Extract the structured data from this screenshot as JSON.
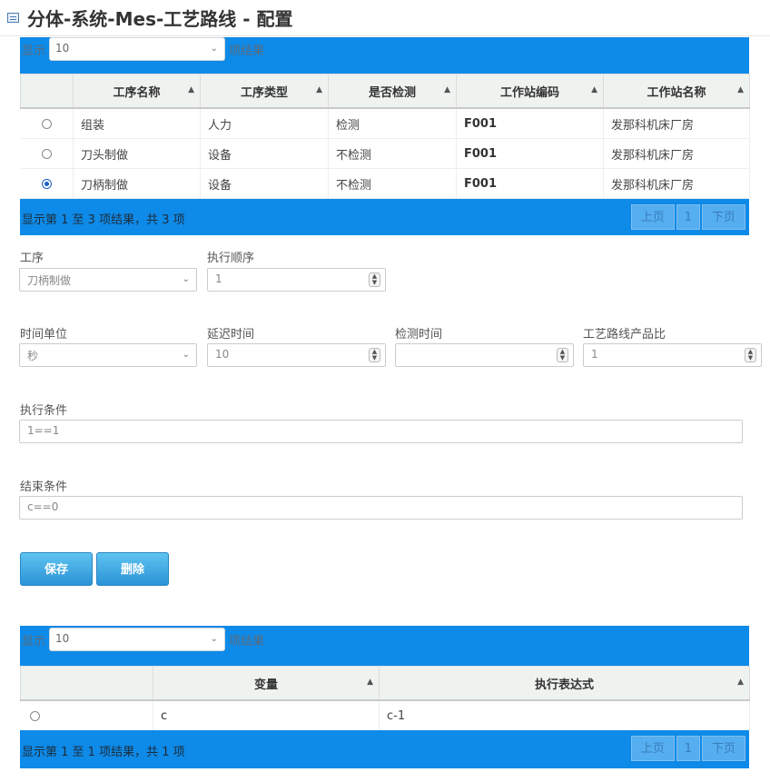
{
  "page": {
    "title": "分体-系统-Mes-工艺路线 - 配置"
  },
  "table1": {
    "length_prefix": "显示",
    "length_value": "10",
    "length_suffix": "项结果",
    "headers": [
      "",
      "工序名称",
      "工序类型",
      "是否检测",
      "工作站编码",
      "工作站名称"
    ],
    "rows": [
      {
        "selected": false,
        "name": "组装",
        "type": "人力",
        "check": "检测",
        "code": "F001",
        "station": "发那科机床厂房"
      },
      {
        "selected": false,
        "name": "刀头制做",
        "type": "设备",
        "check": "不检测",
        "code": "F001",
        "station": "发那科机床厂房"
      },
      {
        "selected": true,
        "name": "刀柄制做",
        "type": "设备",
        "check": "不检测",
        "code": "F001",
        "station": "发那科机床厂房"
      }
    ],
    "info": "显示第 1 至 3 项结果，共 3 项",
    "pager": {
      "prev": "上页",
      "page": "1",
      "next": "下页"
    }
  },
  "form": {
    "process_label": "工序",
    "process_value": "刀柄制做",
    "order_label": "执行顺序",
    "order_value": "1",
    "time_unit_label": "时间单位",
    "time_unit_value": "秒",
    "delay_label": "延迟时间",
    "delay_value": "10",
    "check_time_label": "检测时间",
    "check_time_value": "",
    "ratio_label": "工艺路线产品比",
    "ratio_value": "1",
    "exec_cond_label": "执行条件",
    "exec_cond_value": "1==1",
    "end_cond_label": "结束条件",
    "end_cond_value": "c==0",
    "save_label": "保存",
    "delete_label": "删除"
  },
  "table2": {
    "length_prefix": "显示",
    "length_value": "10",
    "length_suffix": "项结果",
    "headers": [
      "",
      "变量",
      "执行表达式"
    ],
    "rows": [
      {
        "selected": false,
        "var": "c",
        "expr": "c-1"
      }
    ],
    "info": "显示第 1 至 1 项结果，共 1 项",
    "pager": {
      "prev": "上页",
      "page": "1",
      "next": "下页"
    }
  }
}
